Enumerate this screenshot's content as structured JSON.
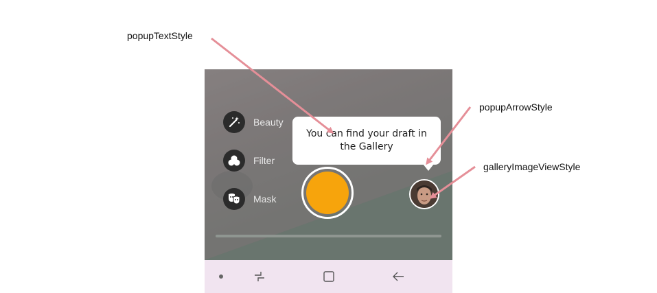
{
  "annotations": {
    "popup_text_style": "popupTextStyle",
    "popup_arrow_style": "popupArrowStyle",
    "gallery_image_view_style": "galleryImageViewStyle"
  },
  "camera": {
    "side_menu": [
      {
        "label": "Beauty",
        "icon": "magic-wand-icon"
      },
      {
        "label": "Filter",
        "icon": "filter-circles-icon"
      },
      {
        "label": "Mask",
        "icon": "theater-mask-icon"
      }
    ],
    "popup": {
      "text": "You can find your draft in the Gallery"
    },
    "shutter_color": "#f7a40c",
    "gallery_thumbnail": "gallery-thumbnail"
  },
  "navigation_bar": {
    "items": [
      "dot-icon",
      "recent-apps-icon",
      "home-icon",
      "back-icon"
    ]
  },
  "colors": {
    "annotation_arrow": "#e58f98",
    "nav_background": "#f1e4f0",
    "shutter": "#f7a40c"
  }
}
